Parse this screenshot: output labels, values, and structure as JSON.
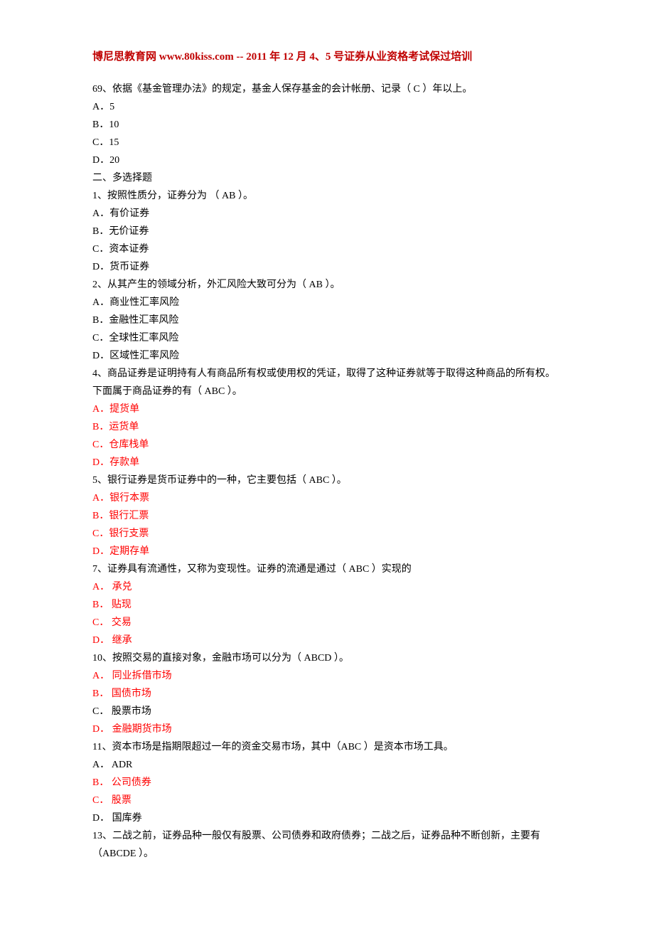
{
  "header": "博尼思教育网 www.80kiss.com -- 2011 年 12 月 4、5 号证券从业资格考试保过培训",
  "lines": [
    {
      "text": "69、依据《基金管理办法》的规定，基金人保存基金的会计帐册、记录（   C   ）年以上。",
      "red": false
    },
    {
      "text": "A．5",
      "red": false
    },
    {
      "text": "B．10",
      "red": false
    },
    {
      "text": "C．15",
      "red": false
    },
    {
      "text": "D．20",
      "red": false
    },
    {
      "text": " 二、多选择题",
      "red": false
    },
    {
      "text": "1、按照性质分，证券分为 （   AB   ）。",
      "red": false
    },
    {
      "text": "A．有价证券",
      "red": false
    },
    {
      "text": "B．无价证券",
      "red": false
    },
    {
      "text": "C．资本证券",
      "red": false
    },
    {
      "text": "D．货币证券",
      "red": false
    },
    {
      "text": "2、从其产生的领域分析，外汇风险大致可分为（   AB   ）。",
      "red": false
    },
    {
      "text": "A．商业性汇率风险",
      "red": false
    },
    {
      "text": "B．金融性汇率风险",
      "red": false
    },
    {
      "text": "C．全球性汇率风险",
      "red": false
    },
    {
      "text": "D．区域性汇率风险",
      "red": false
    },
    {
      "text": "4、商品证券是证明持有人有商品所有权或使用权的凭证，取得了这种证券就等于取得这种商品的所有权。下面属于商品证券的有（   ABC   ）。",
      "red": false
    },
    {
      "text": "A．提货单",
      "red": true
    },
    {
      "text": "B．运货单",
      "red": true
    },
    {
      "text": "C．仓库栈单",
      "red": true
    },
    {
      "text": "D．存款单",
      "red": true
    },
    {
      "text": "5、银行证券是货币证券中的一种，它主要包括（   ABC   ）。",
      "red": false
    },
    {
      "text": "A．银行本票",
      "red": true
    },
    {
      "text": "B．银行汇票",
      "red": true
    },
    {
      "text": "C．银行支票",
      "red": true
    },
    {
      "text": "D．定期存单",
      "red": true
    },
    {
      "text": "7、证券具有流通性，又称为变现性。证券的流通是通过（   ABC   ）实现的",
      "red": false
    },
    {
      "text": "A．  承兑",
      "red": true
    },
    {
      "text": "B．  贴现",
      "red": true
    },
    {
      "text": "C．  交易",
      "red": true
    },
    {
      "text": "D．  继承",
      "red": true
    },
    {
      "text": "10、按照交易的直接对象，金融市场可以分为（   ABCD   ）。",
      "red": false
    },
    {
      "text": "A．  同业拆借市场",
      "red": true
    },
    {
      "text": "B．  国债市场",
      "red": true
    },
    {
      "text": "C．  股票市场",
      "red": false
    },
    {
      "text": "D．  金融期货市场",
      "red": true
    },
    {
      "text": "11、资本市场是指期限超过一年的资金交易市场，其中（ABC      ）是资本市场工具。",
      "red": false
    },
    {
      "text": "A．  ADR",
      "red": false
    },
    {
      "text": "B．  公司债券",
      "red": true
    },
    {
      "text": "C．  股票",
      "red": true
    },
    {
      "text": "D．  国库券",
      "red": false
    },
    {
      "text": "13、二战之前，证券品种一般仅有股票、公司债券和政府债券；二战之后，证券品种不断创新，主要有（ABCDE      ）。",
      "red": false
    }
  ]
}
